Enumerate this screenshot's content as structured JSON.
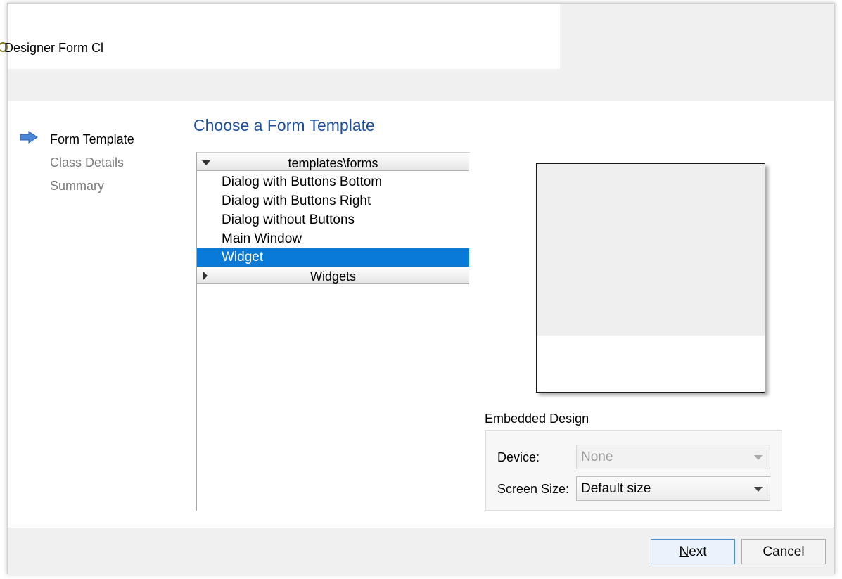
{
  "window": {
    "title": "Designer Form Cl"
  },
  "steps": [
    {
      "label": "Form Template",
      "active": true
    },
    {
      "label": "Class Details",
      "active": false
    },
    {
      "label": "Summary",
      "active": false
    }
  ],
  "page": {
    "heading": "Choose a Form Template"
  },
  "tree": {
    "group_forms": "templates\\forms",
    "items": [
      "Dialog with Buttons Bottom",
      "Dialog with Buttons Right",
      "Dialog without Buttons",
      "Main Window",
      "Widget"
    ],
    "selected": "Widget",
    "group_widgets": "Widgets"
  },
  "embedded": {
    "title": "Embedded Design",
    "device_label": "Device:",
    "device_value": "None",
    "screen_label": "Screen Size:",
    "screen_value": "Default size"
  },
  "buttons": {
    "next_mnemonic": "N",
    "next_rest": "ext",
    "cancel": "Cancel"
  },
  "colors": {
    "heading": "#1d4f9a",
    "selection": "#0a7ad8",
    "step_arrow": "#4a86d8"
  },
  "icons": {
    "current_step": "arrow-right-icon",
    "expanded": "triangle-down-icon",
    "collapsed": "triangle-right-icon"
  }
}
